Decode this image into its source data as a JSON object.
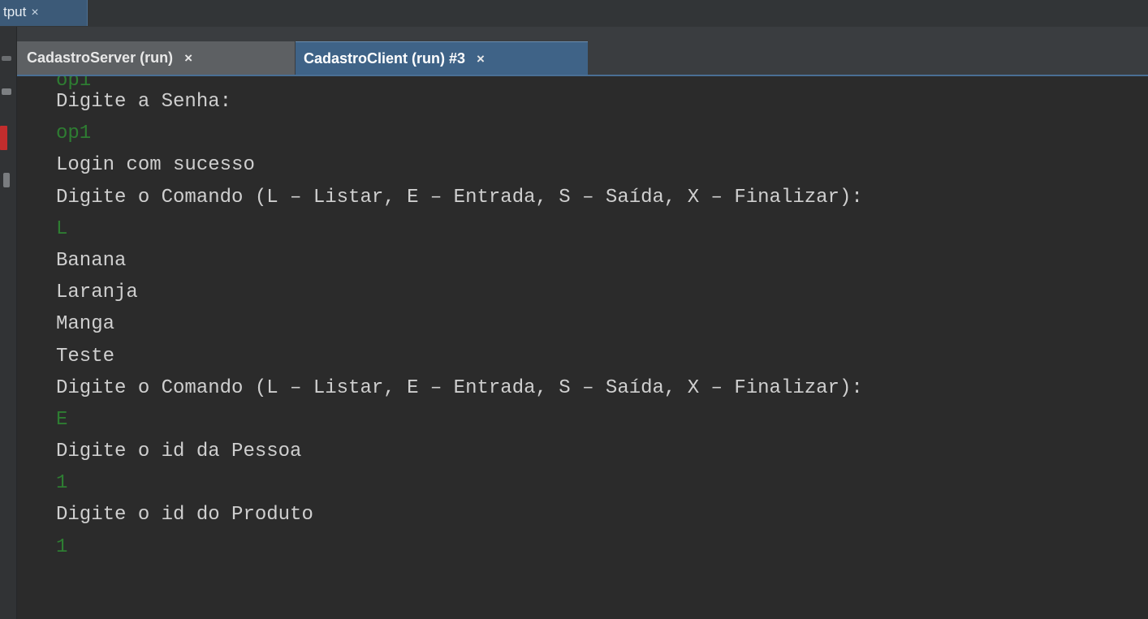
{
  "window": {
    "output_tab_label": "tput",
    "output_tab_close": "×"
  },
  "tabs": [
    {
      "label": "CadastroServer (run)",
      "close": "×",
      "active": false
    },
    {
      "label": "CadastroClient (run) #3",
      "close": "×",
      "active": true
    }
  ],
  "console": {
    "partial_top_line": "op1",
    "lines": [
      {
        "text": "Digite a Senha:",
        "kind": "output"
      },
      {
        "text": "op1",
        "kind": "input"
      },
      {
        "text": "Login com sucesso",
        "kind": "output"
      },
      {
        "text": "Digite o Comando (L – Listar, E – Entrada, S – Saída, X – Finalizar):",
        "kind": "output"
      },
      {
        "text": "L",
        "kind": "input"
      },
      {
        "text": "Banana",
        "kind": "output"
      },
      {
        "text": "Laranja",
        "kind": "output"
      },
      {
        "text": "Manga",
        "kind": "output"
      },
      {
        "text": "Teste",
        "kind": "output"
      },
      {
        "text": "Digite o Comando (L – Listar, E – Entrada, S – Saída, X – Finalizar):",
        "kind": "output"
      },
      {
        "text": "E",
        "kind": "input"
      },
      {
        "text": "Digite o id da Pessoa",
        "kind": "output"
      },
      {
        "text": "1",
        "kind": "input"
      },
      {
        "text": "Digite o id do Produto",
        "kind": "output"
      },
      {
        "text": "1",
        "kind": "input"
      }
    ]
  },
  "colors": {
    "console_background": "#2b2b2b",
    "output_text": "#cfcfcf",
    "input_text": "#2e7d32",
    "active_tab": "#3f6387"
  }
}
